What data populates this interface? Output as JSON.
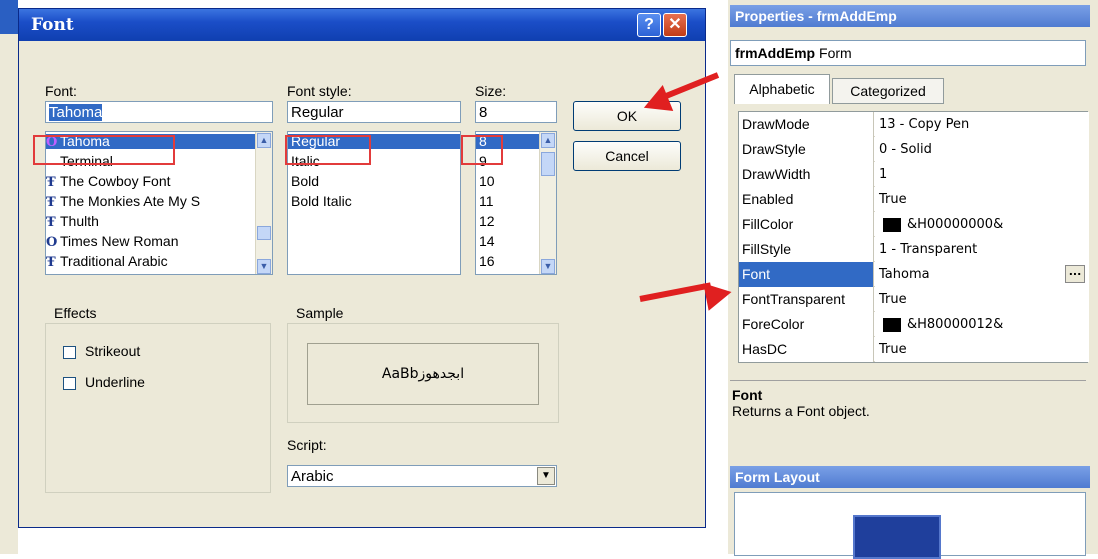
{
  "dialog": {
    "title": "Font",
    "help_glyph": "?",
    "close_glyph": "✕",
    "font_label": "Font:",
    "font_value": "Tahoma",
    "fonts": [
      {
        "name": "Tahoma",
        "icon": "O",
        "icon_name": "opentype-icon"
      },
      {
        "name": "Terminal",
        "icon": "",
        "icon_name": ""
      },
      {
        "name": "The Cowboy Font",
        "icon": "Ŧ",
        "icon_name": "truetype-icon"
      },
      {
        "name": "The Monkies Ate My S",
        "icon": "Ŧ",
        "icon_name": "truetype-icon"
      },
      {
        "name": "Thulth",
        "icon": "Ŧ",
        "icon_name": "truetype-icon"
      },
      {
        "name": "Times New Roman",
        "icon": "O",
        "icon_name": "opentype-icon"
      },
      {
        "name": "Traditional Arabic",
        "icon": "Ŧ",
        "icon_name": "truetype-icon"
      }
    ],
    "style_label": "Font style:",
    "style_value": "Regular",
    "styles": [
      "Regular",
      "Italic",
      "Bold",
      "Bold Italic"
    ],
    "size_label": "Size:",
    "size_value": "8",
    "sizes": [
      "8",
      "9",
      "10",
      "11",
      "12",
      "14",
      "16"
    ],
    "ok_label": "OK",
    "cancel_label": "Cancel",
    "effects_label": "Effects",
    "strikeout_label": "Strikeout",
    "underline_label": "Underline",
    "sample_label": "Sample",
    "sample_text": "AaBbابجدهوز",
    "script_label": "Script:",
    "script_value": "Arabic"
  },
  "properties": {
    "title": "Properties - frmAddEmp",
    "object_name": "frmAddEmp",
    "object_type": "Form",
    "tabs": [
      "Alphabetic",
      "Categorized"
    ],
    "rows": [
      {
        "name": "DrawMode",
        "value": "13 - Copy Pen",
        "swatch": false
      },
      {
        "name": "DrawStyle",
        "value": "0 - Solid",
        "swatch": false
      },
      {
        "name": "DrawWidth",
        "value": "1",
        "swatch": false
      },
      {
        "name": "Enabled",
        "value": "True",
        "swatch": false
      },
      {
        "name": "FillColor",
        "value": "&H00000000&",
        "swatch": true
      },
      {
        "name": "FillStyle",
        "value": "1 - Transparent",
        "swatch": false
      },
      {
        "name": "Font",
        "value": "Tahoma",
        "swatch": false
      },
      {
        "name": "FontTransparent",
        "value": "True",
        "swatch": false
      },
      {
        "name": "ForeColor",
        "value": "&H80000012&",
        "swatch": true
      },
      {
        "name": "HasDC",
        "value": "True",
        "swatch": false
      }
    ],
    "selected_row": "Font",
    "ellipsis": "...",
    "desc_title": "Font",
    "desc_text": "Returns a Font object.",
    "form_layout_title": "Form Layout"
  },
  "colors": {
    "accent": "#316ac5",
    "title_blue": "#0f3fb0",
    "highlight_red": "#e23b3b"
  }
}
